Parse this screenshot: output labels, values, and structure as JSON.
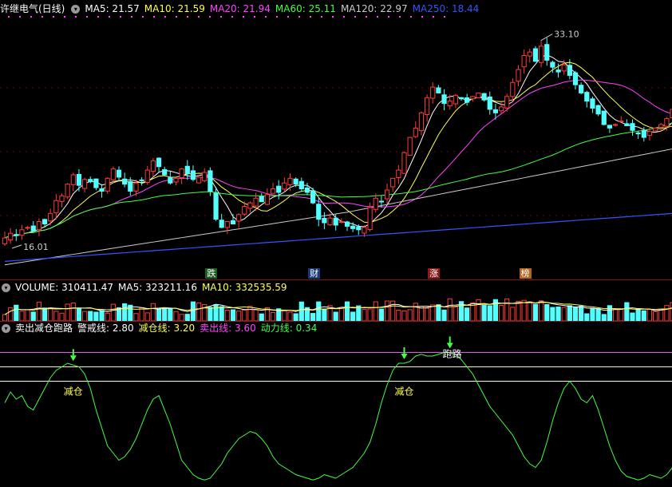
{
  "price_header": {
    "title": "许继电气(日线)",
    "ma": [
      {
        "label": "MA5: 21.57",
        "color": "#ffffff"
      },
      {
        "label": "MA10: 21.59",
        "color": "#ffff55"
      },
      {
        "label": "MA20: 21.94",
        "color": "#ff44ff"
      },
      {
        "label": "MA60: 25.11",
        "color": "#44ff44"
      },
      {
        "label": "MA120: 22.97",
        "color": "#cccccc"
      },
      {
        "label": "MA250: 18.44",
        "color": "#3355ff"
      }
    ]
  },
  "price_chart": {
    "high_label": "33.10",
    "low_label": "16.01",
    "high_index": 94,
    "low_index": 1,
    "tags": [
      {
        "text": "跌",
        "bg": "#1b5e20",
        "color": "#ffffff",
        "index": 36
      },
      {
        "text": "财",
        "bg": "#1a3b7a",
        "color": "#ffffff",
        "index": 54
      },
      {
        "text": "涨",
        "bg": "#8b1a1a",
        "color": "#ffffff",
        "index": 75
      },
      {
        "text": "榜",
        "bg": "#b5651d",
        "color": "#ffffff",
        "index": 91
      }
    ],
    "closes": [
      16.2,
      16.6,
      16.4,
      16.9,
      17.1,
      16.8,
      17.6,
      17.4,
      18.3,
      19.4,
      19.8,
      20.8,
      21.6,
      20.7,
      21.2,
      21.0,
      20.5,
      20.2,
      21.3,
      22.1,
      21.4,
      20.8,
      20.2,
      20.9,
      21.1,
      22.0,
      22.8,
      22.3,
      21.6,
      20.9,
      21.3,
      22.1,
      21.7,
      21.2,
      21.4,
      21.8,
      20.2,
      17.8,
      17.1,
      17.6,
      17.4,
      18.2,
      18.9,
      19.2,
      19.6,
      19.3,
      19.9,
      20.4,
      20.1,
      20.9,
      21.3,
      20.8,
      20.4,
      20.1,
      19.2,
      17.8,
      17.5,
      17.9,
      17.3,
      17.6,
      17.2,
      17.0,
      16.9,
      17.1,
      18.8,
      19.6,
      19.3,
      20.3,
      21.3,
      22.0,
      23.5,
      24.8,
      25.6,
      26.9,
      28.2,
      29.1,
      28.6,
      27.7,
      27.9,
      28.4,
      28.1,
      27.8,
      28.3,
      28.6,
      28.0,
      27.2,
      26.9,
      27.4,
      28.3,
      29.5,
      30.6,
      31.8,
      32.1,
      31.3,
      32.6,
      31.4,
      30.8,
      30.4,
      31.0,
      30.1,
      29.3,
      28.6,
      27.9,
      27.3,
      26.8,
      25.9,
      25.6,
      25.9,
      26.2,
      25.8,
      25.4,
      25.1,
      24.8,
      25.3,
      25.6,
      25.9,
      26.4,
      27.2,
      28.1
    ]
  },
  "volume_header": {
    "title": "VOLUME: 310411.47",
    "ma5": "MA5: 323211.16",
    "ma10": "MA10: 332535.59"
  },
  "indicator_header": {
    "title": "卖出减仓跑路",
    "warn": "警戒线: 2.80",
    "reduce": "减仓线: 3.20",
    "sell": "卖出线: 3.60",
    "power": "动力线: 0.34"
  },
  "indicator_chart": {
    "levels": {
      "warn": 2.8,
      "reduce": 3.2,
      "sell": 3.6
    },
    "labels": [
      {
        "text": "减仓",
        "index": 12
      },
      {
        "text": "减仓",
        "index": 70
      },
      {
        "text": "跑路",
        "index": 77
      }
    ],
    "values": [
      2.2,
      2.5,
      2.3,
      2.4,
      2.1,
      2.0,
      2.3,
      2.6,
      2.9,
      3.1,
      3.2,
      3.3,
      3.25,
      3.2,
      3.0,
      2.6,
      2.0,
      1.5,
      1.0,
      0.8,
      0.6,
      0.7,
      0.9,
      1.2,
      1.6,
      2.0,
      2.3,
      2.4,
      2.0,
      1.6,
      1.1,
      0.6,
      0.4,
      0.2,
      0.1,
      0.05,
      0.1,
      0.3,
      0.5,
      0.8,
      1.0,
      1.2,
      1.3,
      1.4,
      1.35,
      1.2,
      1.0,
      0.7,
      0.5,
      0.4,
      0.3,
      0.2,
      0.15,
      0.1,
      0.05,
      0.1,
      0.2,
      0.15,
      0.1,
      0.2,
      0.3,
      0.4,
      0.6,
      0.8,
      1.1,
      1.6,
      2.2,
      2.7,
      3.1,
      3.3,
      3.3,
      3.35,
      3.5,
      3.55,
      3.5,
      3.5,
      3.55,
      3.6,
      3.6,
      3.55,
      3.4,
      3.2,
      3.0,
      2.7,
      2.4,
      2.1,
      1.9,
      1.7,
      1.5,
      1.3,
      1.0,
      0.7,
      0.5,
      0.4,
      0.6,
      1.1,
      1.7,
      2.2,
      2.6,
      2.8,
      2.6,
      2.3,
      2.2,
      2.4,
      2.0,
      1.5,
      1.0,
      0.6,
      0.3,
      0.15,
      0.1,
      0.05,
      0.1,
      0.2,
      0.15,
      0.1,
      0.2,
      0.4,
      0.6,
      0.8
    ]
  },
  "colors": {
    "up": "#ff3b3b",
    "down": "#54ffff",
    "separator": "#7a1a1a"
  }
}
